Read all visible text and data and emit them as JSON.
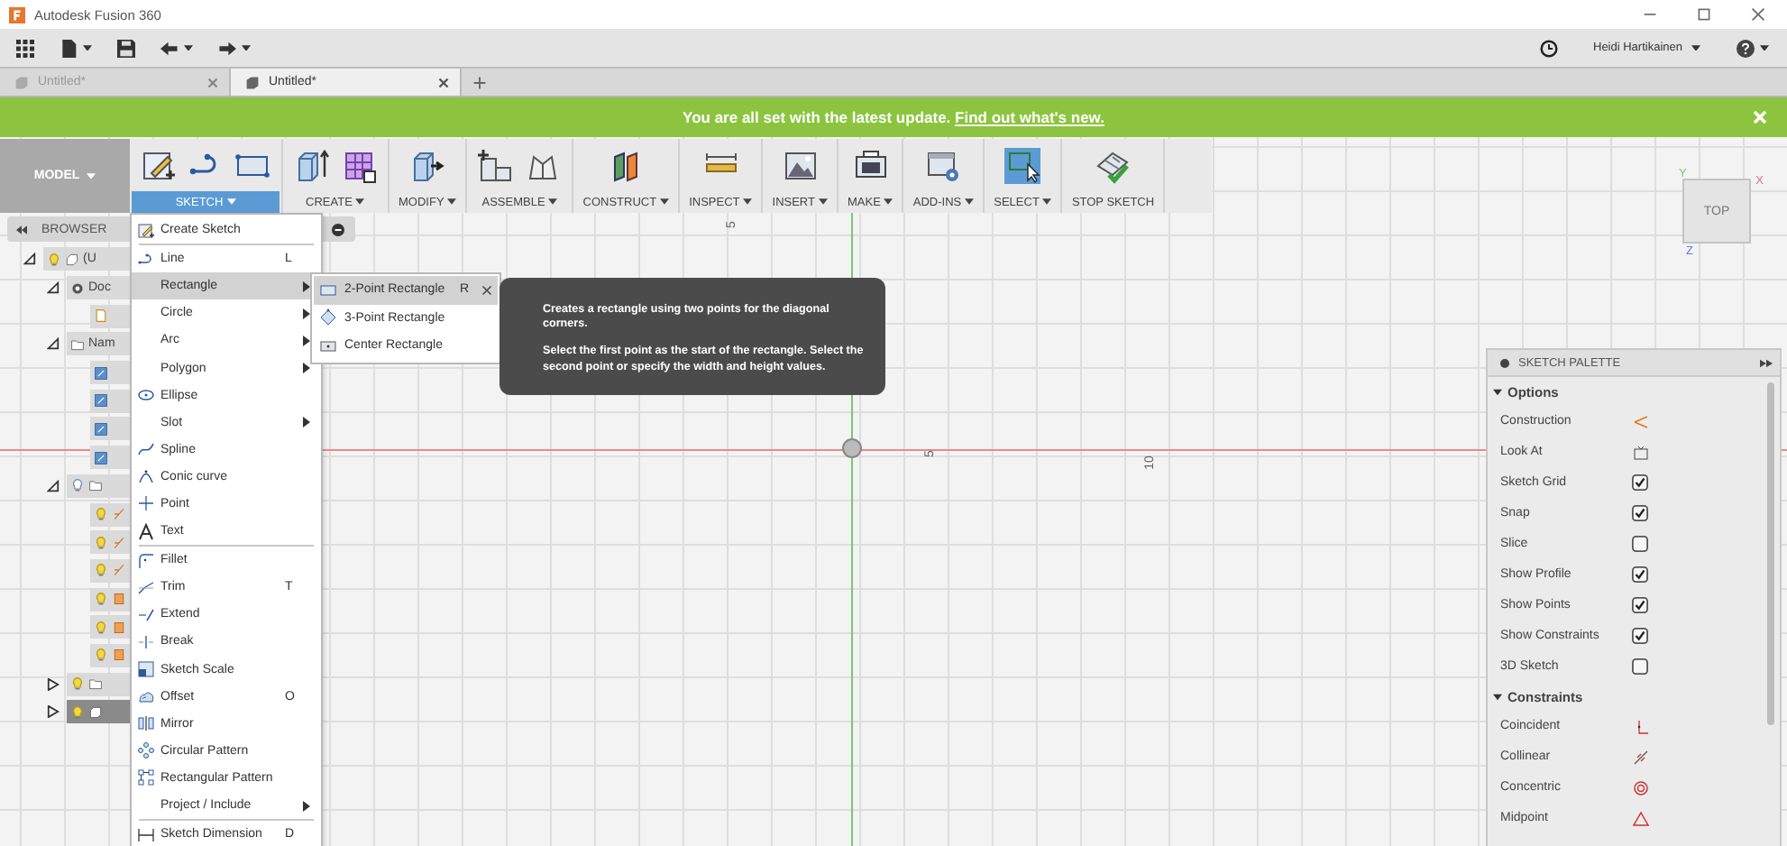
{
  "window": {
    "title": "Autodesk Fusion 360"
  },
  "account": {
    "user": "Heidi Hartikainen"
  },
  "tabs": [
    {
      "label": "Untitled*",
      "selected": false
    },
    {
      "label": "Untitled*",
      "selected": true
    }
  ],
  "banner": {
    "text": "You are all set with the latest update.",
    "link": "Find out what's new."
  },
  "ribbon": {
    "workspace": "MODEL",
    "groups": [
      {
        "label": "SKETCH",
        "selected": true,
        "dropdown": true
      },
      {
        "label": "CREATE",
        "selected": false,
        "dropdown": true
      },
      {
        "label": "MODIFY",
        "selected": false,
        "dropdown": true
      },
      {
        "label": "ASSEMBLE",
        "selected": false,
        "dropdown": true
      },
      {
        "label": "CONSTRUCT",
        "selected": false,
        "dropdown": true
      },
      {
        "label": "INSPECT",
        "selected": false,
        "dropdown": true
      },
      {
        "label": "INSERT",
        "selected": false,
        "dropdown": true
      },
      {
        "label": "MAKE",
        "selected": false,
        "dropdown": true
      },
      {
        "label": "ADD-INS",
        "selected": false,
        "dropdown": true
      },
      {
        "label": "SELECT",
        "selected": false,
        "dropdown": true
      },
      {
        "label": "STOP SKETCH",
        "selected": false,
        "dropdown": false
      }
    ]
  },
  "browser": {
    "title": "BROWSER",
    "tree": [
      {
        "label": "(U",
        "kind": "component",
        "visible": true,
        "expanded": true,
        "selected": false,
        "children": [
          {
            "label": "Doc",
            "kind": "settings",
            "expanded": true,
            "selected": false,
            "children": [
              {
                "kind": "document",
                "selected": false
              }
            ]
          },
          {
            "label": "Nam",
            "kind": "folder",
            "expanded": true,
            "selected": false,
            "children": [
              {
                "kind": "sketch",
                "selected": false
              },
              {
                "kind": "sketch",
                "selected": false
              },
              {
                "kind": "sketch",
                "selected": false
              },
              {
                "kind": "sketch",
                "selected": false
              }
            ]
          },
          {
            "kind": "folder",
            "visible": false,
            "expanded": true,
            "selected": false,
            "children": [
              {
                "kind": "constraint",
                "visible": true,
                "selected": false
              },
              {
                "kind": "constraint",
                "visible": true,
                "selected": false
              },
              {
                "kind": "constraint",
                "visible": true,
                "selected": false
              },
              {
                "kind": "dimension",
                "visible": true,
                "selected": false
              },
              {
                "kind": "dimension",
                "visible": true,
                "selected": false
              },
              {
                "kind": "dimension",
                "visible": true,
                "selected": false
              }
            ]
          },
          {
            "kind": "folder",
            "visible": true,
            "expanded": false,
            "selected": false
          },
          {
            "kind": "body",
            "visible": true,
            "expanded": false,
            "selected": true
          }
        ]
      }
    ]
  },
  "sketch_menu": [
    {
      "kind": "item",
      "label": "Create Sketch",
      "selected": false
    },
    {
      "kind": "separator"
    },
    {
      "kind": "item",
      "label": "Line",
      "shortcut": "L",
      "selected": false
    },
    {
      "kind": "submenu",
      "label": "Rectangle",
      "selected": true
    },
    {
      "kind": "submenu",
      "label": "Circle",
      "selected": false
    },
    {
      "kind": "submenu",
      "label": "Arc",
      "selected": false
    },
    {
      "kind": "submenu",
      "label": "Polygon",
      "selected": false
    },
    {
      "kind": "item",
      "label": "Ellipse",
      "selected": false
    },
    {
      "kind": "submenu",
      "label": "Slot",
      "selected": false
    },
    {
      "kind": "item",
      "label": "Spline",
      "selected": false
    },
    {
      "kind": "item",
      "label": "Conic curve",
      "selected": false
    },
    {
      "kind": "item",
      "label": "Point",
      "selected": false
    },
    {
      "kind": "item",
      "label": "Text",
      "selected": false
    },
    {
      "kind": "separator"
    },
    {
      "kind": "item",
      "label": "Fillet",
      "selected": false
    },
    {
      "kind": "item",
      "label": "Trim",
      "shortcut": "T",
      "selected": false
    },
    {
      "kind": "item",
      "label": "Extend",
      "selected": false
    },
    {
      "kind": "item",
      "label": "Break",
      "selected": false
    },
    {
      "kind": "item",
      "label": "Sketch Scale",
      "selected": false
    },
    {
      "kind": "item",
      "label": "Offset",
      "shortcut": "O",
      "selected": false
    },
    {
      "kind": "item",
      "label": "Mirror",
      "selected": false
    },
    {
      "kind": "item",
      "label": "Circular Pattern",
      "selected": false
    },
    {
      "kind": "item",
      "label": "Rectangular Pattern",
      "selected": false
    },
    {
      "kind": "submenu",
      "label": "Project / Include",
      "selected": false
    },
    {
      "kind": "separator"
    },
    {
      "kind": "item",
      "label": "Sketch Dimension",
      "shortcut": "D",
      "selected": false
    }
  ],
  "rectangle_submenu": [
    {
      "label": "2-Point Rectangle",
      "shortcut": "R",
      "selected": true
    },
    {
      "label": "3-Point Rectangle",
      "selected": false
    },
    {
      "label": "Center Rectangle",
      "selected": false
    }
  ],
  "tooltip": [
    "Creates a rectangle using two points for the diagonal corners.",
    "Select the first point as the start of the rectangle. Select the second point or specify the width and height values."
  ],
  "canvas": {
    "axis_labels": [
      "5",
      "5",
      "10"
    ]
  },
  "view_cube": {
    "face": "TOP",
    "axes": [
      "Y",
      "X",
      "Z"
    ]
  },
  "sketch_palette": {
    "title": "SKETCH PALETTE",
    "sections": [
      {
        "label": "Options",
        "expanded": true,
        "rows": [
          {
            "label": "Construction",
            "kind": "icon"
          },
          {
            "label": "Look At",
            "kind": "icon"
          },
          {
            "label": "Sketch Grid",
            "kind": "checkbox",
            "checked": true
          },
          {
            "label": "Snap",
            "kind": "checkbox",
            "checked": true
          },
          {
            "label": "Slice",
            "kind": "checkbox",
            "checked": false
          },
          {
            "label": "Show Profile",
            "kind": "checkbox",
            "checked": true
          },
          {
            "label": "Show Points",
            "kind": "checkbox",
            "checked": true
          },
          {
            "label": "Show Constraints",
            "kind": "checkbox",
            "checked": true
          },
          {
            "label": "3D Sketch",
            "kind": "checkbox",
            "checked": false
          }
        ]
      },
      {
        "label": "Constraints",
        "expanded": true,
        "rows": [
          {
            "label": "Coincident",
            "kind": "icon"
          },
          {
            "label": "Collinear",
            "kind": "icon"
          },
          {
            "label": "Concentric",
            "kind": "icon"
          },
          {
            "label": "Midpoint",
            "kind": "icon"
          }
        ]
      }
    ]
  }
}
